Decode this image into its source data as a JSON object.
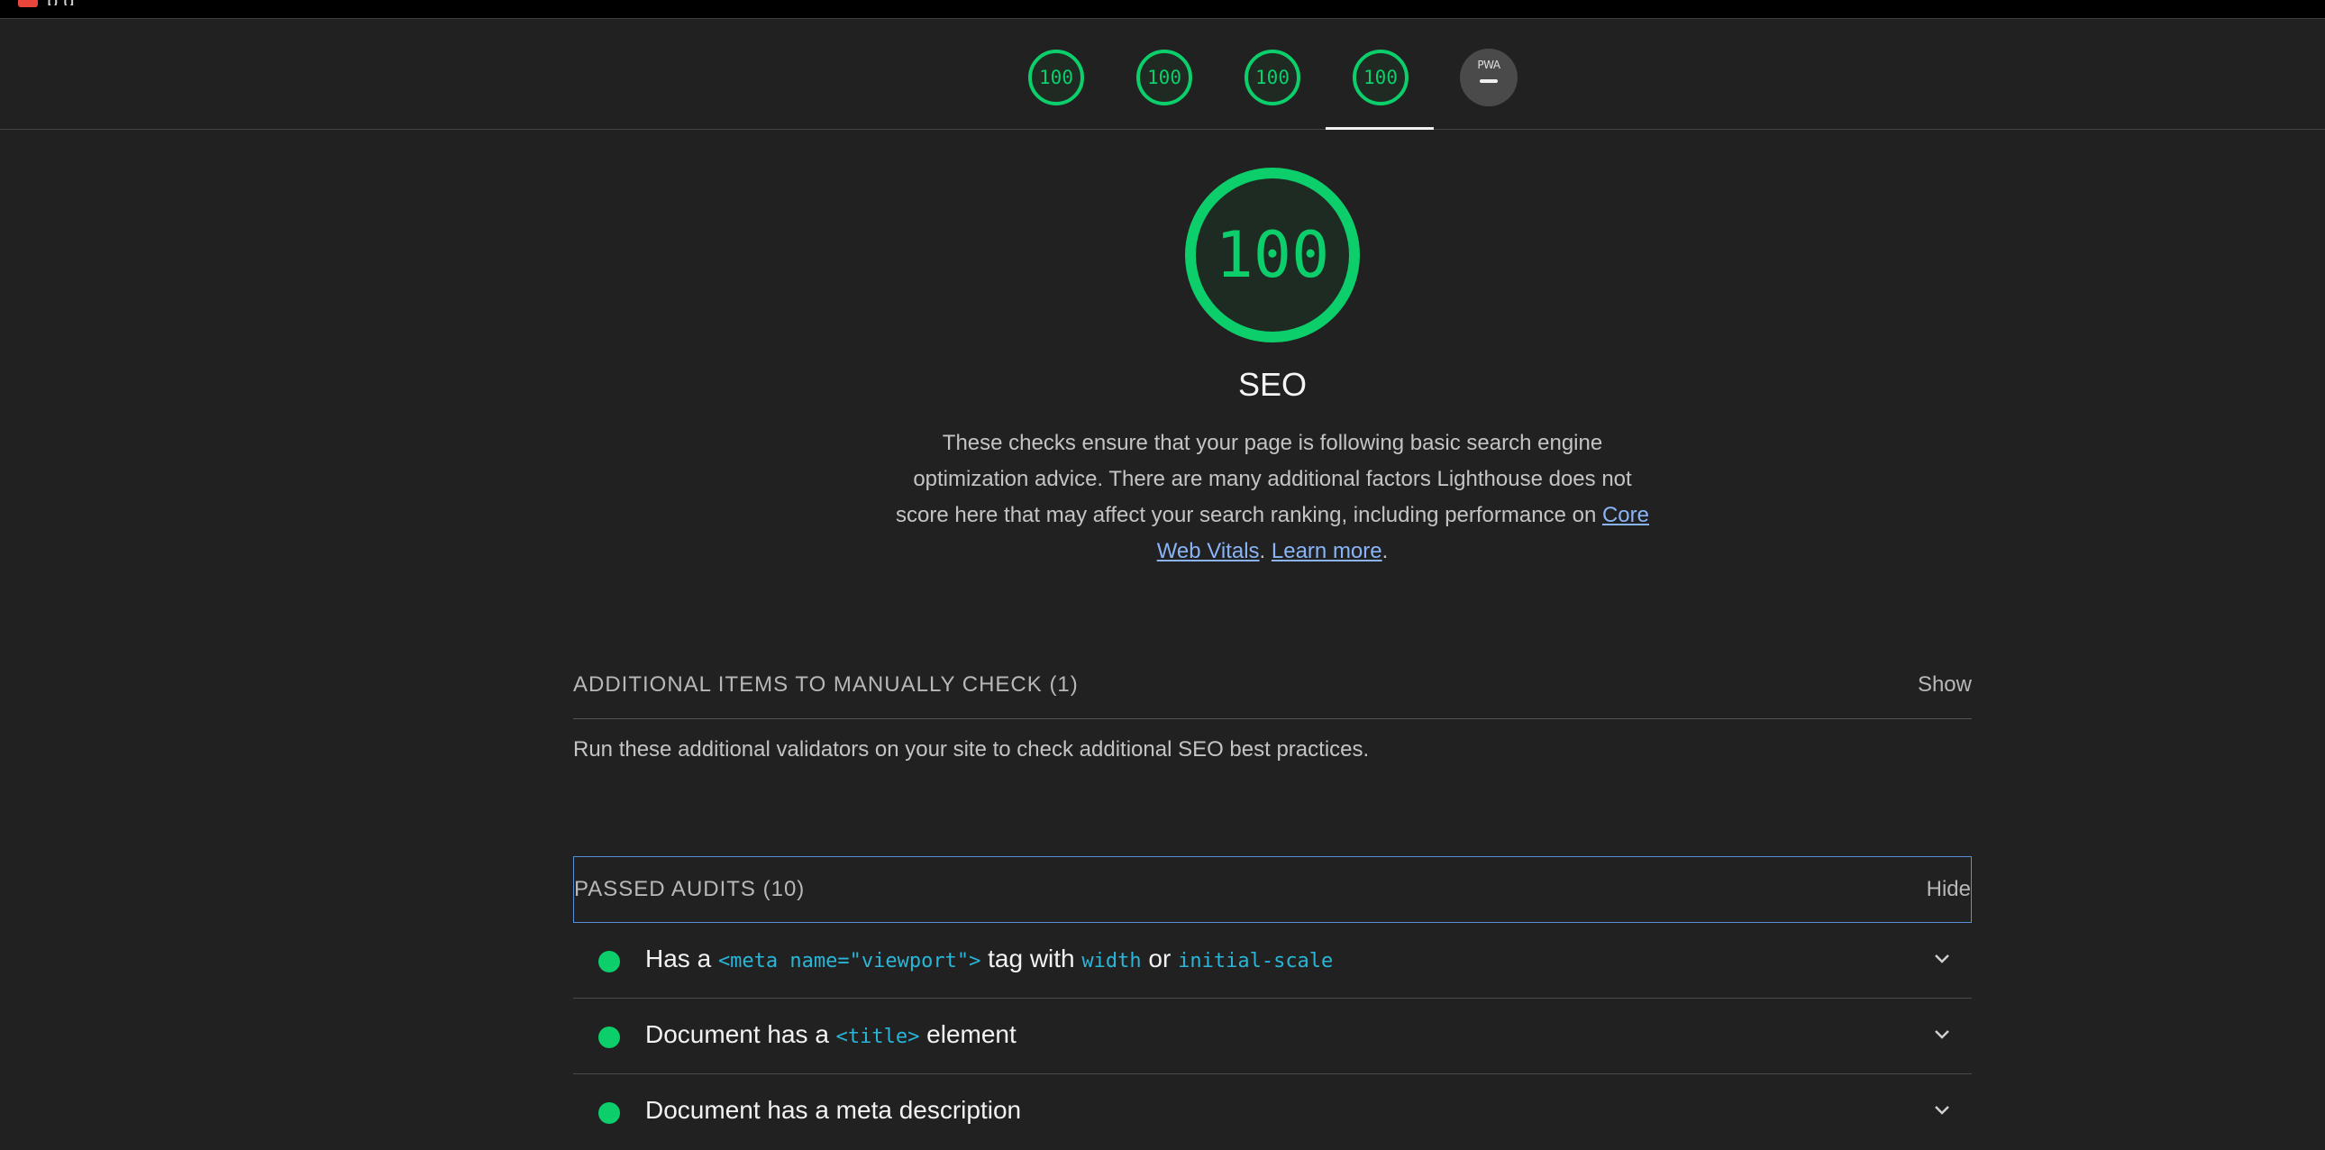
{
  "window": {
    "title_fragment": "p          g"
  },
  "nav": {
    "scores": [
      "100",
      "100",
      "100",
      "100"
    ],
    "pwa_label": "PWA",
    "active_index": 3
  },
  "category": {
    "score": "100",
    "score_fraction": 1.0,
    "title": "SEO",
    "description_text": "These checks ensure that your page is following basic search engine optimization advice. There are many additional factors Lighthouse does not score here that may affect your search ranking, including performance on",
    "link_core_web_vitals": "Core Web Vitals",
    "separator": ". ",
    "link_learn_more": "Learn more",
    "end_period": "."
  },
  "manual_group": {
    "title": "Additional items to manually check (1)",
    "toggle": "Show",
    "description": "Run these additional validators on your site to check additional SEO best practices."
  },
  "passed_group": {
    "title": "Passed audits (10)",
    "toggle": "Hide"
  },
  "audits": [
    {
      "prefix": "Has a ",
      "code1": "<meta name=\"viewport\">",
      "middle": " tag with ",
      "code2": "width",
      "or": " or ",
      "code3": "initial-scale"
    },
    {
      "prefix": "Document has a ",
      "code1": "<title>",
      "suffix": " element"
    },
    {
      "text": "Document has a meta description"
    }
  ],
  "colors": {
    "pass": "#0cce6b",
    "background": "#212121",
    "link": "#8ab4f8",
    "code": "#29b6d8"
  }
}
